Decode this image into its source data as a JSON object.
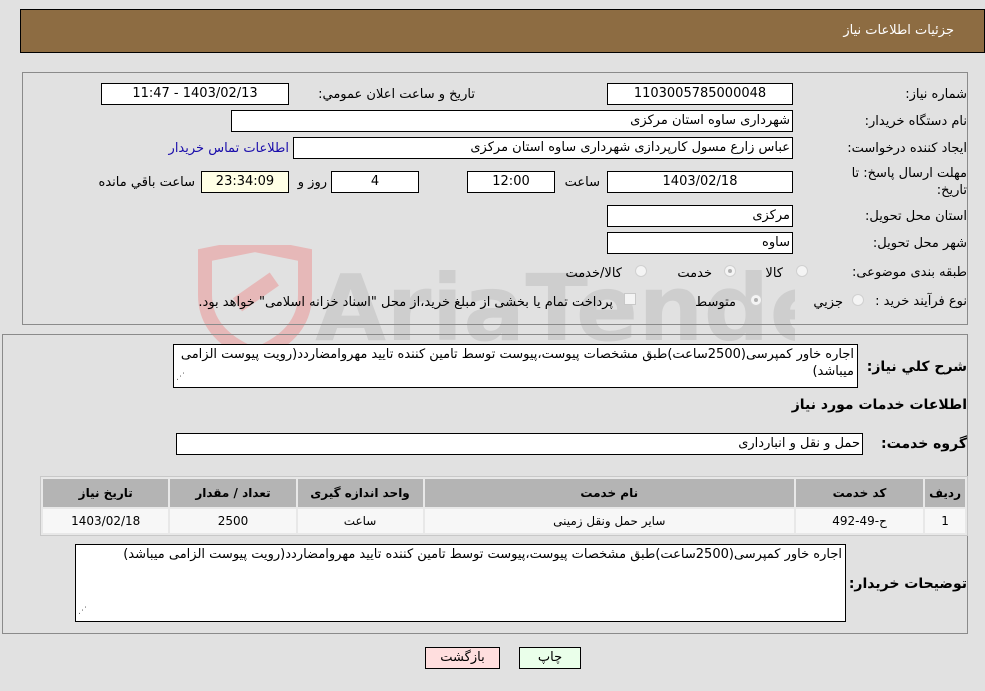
{
  "header": {
    "title": "جزئیات اطلاعات نیاز"
  },
  "fields": {
    "need_number": {
      "label": "شماره نیاز:",
      "value": "1103005785000048"
    },
    "announce_datetime": {
      "label": "تاریخ و ساعت اعلان عمومي:",
      "value": "1403/02/13 - 11:47"
    },
    "buyer_org": {
      "label": "نام دستگاه خریدار:",
      "value": "شهرداری ساوه استان مرکزی"
    },
    "requester": {
      "label": "ایجاد کننده درخواست:",
      "value": "عباس زارع مسول کارپردازی شهرداری ساوه استان مرکزی",
      "contact_link": "اطلاعات تماس خریدار"
    },
    "deadline": {
      "label": "مهلت ارسال پاسخ: تا تاریخ:",
      "date": "1403/02/18",
      "time_label": "ساعت",
      "time": "12:00",
      "days": "4",
      "days_label": "روز و",
      "remaining": "23:34:09",
      "remaining_label": "ساعت باقي مانده"
    },
    "province": {
      "label": "استان محل تحویل:",
      "value": "مرکزی"
    },
    "city": {
      "label": "شهر محل تحویل:",
      "value": "ساوه"
    },
    "category": {
      "label": "طبقه بندی موضوعی:",
      "options": [
        {
          "label": "کالا",
          "checked": false
        },
        {
          "label": "خدمت",
          "checked": true
        },
        {
          "label": "کالا/خدمت",
          "checked": false
        }
      ]
    },
    "purchase_type": {
      "label": "نوع فرآیند خرید :",
      "options": [
        {
          "label": "جزيي",
          "checked": false
        },
        {
          "label": "متوسط",
          "checked": true
        }
      ],
      "treasury_checkbox_label": "پرداخت تمام یا بخشی از مبلغ خرید،از محل \"اسناد خزانه اسلامی\" خواهد بود."
    }
  },
  "description": {
    "label": "شرح کلي نیاز:",
    "value": "اجاره خاور  کمپرسی(2500ساعت)طبق مشخصات پیوست،پیوست توسط تامین کننده تایید مهروامضاردد(رویت پیوست الزامی میباشد)"
  },
  "services_section": {
    "title": "اطلاعات خدمات مورد نیاز",
    "group_label": "گروه خدمت:",
    "group_value": "حمل و نقل و انبارداری"
  },
  "table": {
    "headers": [
      "ردیف",
      "کد خدمت",
      "نام خدمت",
      "واحد اندازه گیری",
      "تعداد / مقدار",
      "تاریخ نیاز"
    ],
    "rows": [
      [
        "1",
        "ح-49-492",
        "سایر حمل ونقل زمینی",
        "ساعت",
        "2500",
        "1403/02/18"
      ]
    ]
  },
  "buyer_notes": {
    "label": "توضیحات خریدار:",
    "value": "اجاره خاور  کمپرسی(2500ساعت)طبق مشخصات پیوست،پیوست توسط تامین کننده تایید مهروامضاردد(رویت پیوست الزامی میباشد)"
  },
  "buttons": {
    "print": "چاپ",
    "back": "بازگشت"
  },
  "watermark": {
    "text": "AriaTender.neT"
  },
  "colors": {
    "header_bg": "#8d6c42",
    "page_bg": "#e1e1e1",
    "print_btn": "#eaffea",
    "back_btn": "#ffdede",
    "link": "#1a0dab"
  }
}
